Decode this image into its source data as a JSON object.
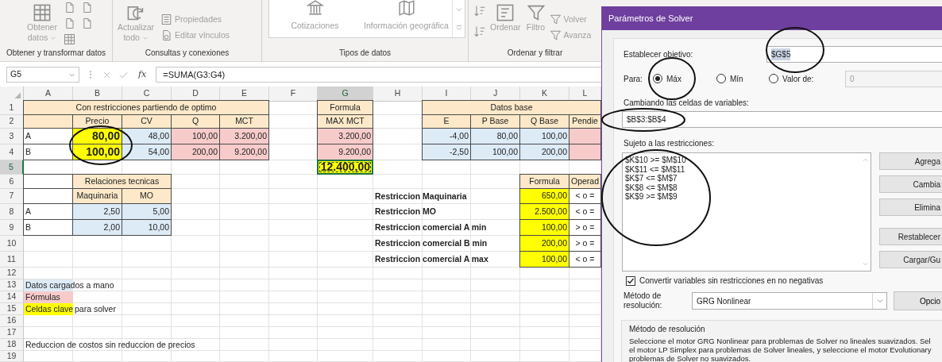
{
  "ribbon": [
    {
      "label": "Obtener y transformar datos",
      "buttons": [
        {
          "kind": "large",
          "lines": [
            "Obtener",
            "datos"
          ],
          "dropdown": true
        }
      ]
    },
    {
      "label": "Consultas y conexiones",
      "buttons": [
        {
          "kind": "large",
          "lines": [
            "Actualizar",
            "todo"
          ],
          "dropdown": true
        },
        {
          "kind": "small",
          "lines": [
            "Propiedades"
          ]
        },
        {
          "kind": "small",
          "lines": [
            "Editar vínculos"
          ]
        }
      ]
    },
    {
      "label": "Tipos de datos",
      "buttons": [
        {
          "kind": "gallery",
          "lines": [
            "Cotizaciones"
          ]
        },
        {
          "kind": "gallery",
          "lines": [
            "Información geográfica"
          ]
        }
      ]
    },
    {
      "label": "Ordenar y filtrar",
      "buttons": [
        {
          "kind": "large",
          "lines": [
            "Ordenar"
          ]
        },
        {
          "kind": "large",
          "lines": [
            "Filtro"
          ]
        },
        {
          "kind": "small",
          "lines": [
            "Volver"
          ]
        },
        {
          "kind": "small",
          "lines": [
            "Avanza"
          ]
        }
      ]
    }
  ],
  "formula_bar": {
    "name_box": "G5",
    "function_label": "fx",
    "formula": "=SUMA(G3:G4)"
  },
  "sheet": {
    "columns": [
      {
        "label": "A",
        "selected": false
      },
      {
        "label": "B",
        "selected": false
      },
      {
        "label": "C",
        "selected": false
      },
      {
        "label": "D",
        "selected": false
      },
      {
        "label": "E",
        "selected": false
      },
      {
        "label": "F",
        "selected": false
      },
      {
        "label": "G",
        "selected": true
      },
      {
        "label": "H",
        "selected": false
      },
      {
        "label": "I",
        "selected": false
      },
      {
        "label": "J",
        "selected": false
      },
      {
        "label": "K",
        "selected": false
      },
      {
        "label": "L",
        "selected": false
      }
    ],
    "rows": [
      {
        "number": "1",
        "selected": false,
        "cells": [
          {
            "text": "Con restricciones partiendo de optimo",
            "kind": "header",
            "color": "#fde9c9",
            "boxed": true
          },
          {
            "merged": true
          },
          {
            "merged": true
          },
          {
            "merged": true
          },
          {
            "merged": true
          },
          null,
          {
            "text": "Formula",
            "kind": "header",
            "color": "#fde9c9",
            "boxed": true
          },
          null,
          {
            "text": "Datos base",
            "kind": "header",
            "color": "#fde9c9",
            "boxed": true
          },
          {
            "merged": true
          },
          {
            "merged": true
          },
          {
            "merged": true
          }
        ]
      },
      {
        "number": "2",
        "selected": false,
        "cells": [
          {
            "kind": "header",
            "color": "#fde9c9",
            "boxed": true
          },
          {
            "text": "Precio",
            "kind": "header",
            "color": "#fde9c9",
            "boxed": true
          },
          {
            "text": "CV",
            "kind": "header",
            "color": "#fde9c9",
            "boxed": true
          },
          {
            "text": "Q",
            "kind": "header",
            "color": "#fde9c9",
            "boxed": true
          },
          {
            "text": "MCT",
            "kind": "header",
            "color": "#fde9c9",
            "boxed": true
          },
          null,
          {
            "text": "MAX MCT",
            "kind": "header",
            "color": "#fde9c9",
            "boxed": true
          },
          null,
          {
            "text": "E",
            "kind": "header",
            "color": "#fde9c9",
            "boxed": true
          },
          {
            "text": "P Base",
            "kind": "header",
            "color": "#fde9c9",
            "boxed": true
          },
          {
            "text": "Q Base",
            "kind": "header",
            "color": "#fde9c9",
            "boxed": true
          },
          {
            "text": "Pendie",
            "kind": "header",
            "color": "#fde9c9",
            "boxed": true
          }
        ]
      },
      {
        "number": "3",
        "selected": false,
        "cells": [
          {
            "text": "A",
            "kind": "label",
            "boxed": true
          },
          {
            "text": "80,00",
            "kind": "number",
            "color": "#ffff00",
            "bold": true,
            "boxed": true
          },
          {
            "text": "48,00",
            "kind": "number",
            "color": "#ddebf7",
            "boxed": true
          },
          {
            "text": "100,00",
            "kind": "number",
            "color": "#f8cbcb",
            "boxed": true
          },
          {
            "text": "3.200,00",
            "kind": "number",
            "color": "#f8cbcb",
            "boxed": true
          },
          null,
          {
            "text": "3.200,00",
            "kind": "number",
            "color": "#f8cbcb",
            "boxed": true
          },
          null,
          {
            "text": "-4,00",
            "kind": "number",
            "color": "#ddebf7",
            "boxed": true
          },
          {
            "text": "80,00",
            "kind": "number",
            "color": "#ddebf7",
            "boxed": true
          },
          {
            "text": "100,00",
            "kind": "number",
            "color": "#ddebf7",
            "boxed": true
          },
          {
            "kind": "number",
            "color": "#f8cbcb",
            "boxed": true
          }
        ]
      },
      {
        "number": "4",
        "selected": false,
        "cells": [
          {
            "text": "B",
            "kind": "label",
            "boxed": true
          },
          {
            "text": "100,00",
            "kind": "number",
            "color": "#ffff00",
            "bold": true,
            "boxed": true
          },
          {
            "text": "54,00",
            "kind": "number",
            "color": "#ddebf7",
            "boxed": true
          },
          {
            "text": "200,00",
            "kind": "number",
            "color": "#f8cbcb",
            "boxed": true
          },
          {
            "text": "9.200,00",
            "kind": "number",
            "color": "#f8cbcb",
            "boxed": true
          },
          null,
          {
            "text": "9.200,00",
            "kind": "number",
            "color": "#f8cbcb",
            "boxed": true
          },
          null,
          {
            "text": "-2,50",
            "kind": "number",
            "color": "#ddebf7",
            "boxed": true
          },
          {
            "text": "100,00",
            "kind": "number",
            "color": "#ddebf7",
            "boxed": true
          },
          {
            "text": "200,00",
            "kind": "number",
            "color": "#ddebf7",
            "boxed": true
          },
          {
            "kind": "number",
            "color": "#f8cbcb",
            "boxed": true
          }
        ]
      },
      {
        "number": "5",
        "selected": true,
        "cells": [
          null,
          null,
          null,
          null,
          null,
          null,
          {
            "text": "12.400,00",
            "kind": "number",
            "color": "#ffff00",
            "bold": true,
            "boxed": true
          }
        ]
      },
      {
        "number": "6",
        "selected": false,
        "cells": [
          {
            "kind": "label",
            "boxed": true
          },
          {
            "text": "Relaciones tecnicas",
            "kind": "header",
            "color": "#fde9c9",
            "boxed": true
          },
          {
            "merged": true
          },
          null,
          null,
          null,
          null,
          null,
          null,
          null,
          {
            "text": "Formula",
            "kind": "header",
            "color": "#fde9c9",
            "boxed": true
          },
          {
            "text": "Operad",
            "kind": "header",
            "color": "#fde9c9",
            "boxed": true
          }
        ]
      },
      {
        "number": "7",
        "selected": false,
        "cells": [
          {
            "kind": "label",
            "boxed": true
          },
          {
            "text": "Maquinaria",
            "kind": "header",
            "color": "#fde9c9",
            "boxed": true
          },
          {
            "text": "MO",
            "kind": "header",
            "color": "#fde9c9",
            "boxed": true
          },
          null,
          null,
          null,
          null,
          {
            "text": "Restriccion Maquinaria",
            "kind": "label",
            "bold": true
          },
          null,
          null,
          {
            "text": "650,00",
            "kind": "number",
            "color": "#ffff00",
            "boxed": true
          },
          {
            "text": "< o =",
            "kind": "center",
            "boxed": true
          }
        ]
      },
      {
        "number": "8",
        "selected": false,
        "cells": [
          {
            "text": "A",
            "kind": "label",
            "boxed": true
          },
          {
            "text": "2,50",
            "kind": "number",
            "color": "#ddebf7",
            "boxed": true
          },
          {
            "text": "5,00",
            "kind": "number",
            "color": "#ddebf7",
            "boxed": true
          },
          null,
          null,
          null,
          null,
          {
            "text": "Restriccion MO",
            "kind": "label",
            "bold": true
          },
          null,
          null,
          {
            "text": "2.500,00",
            "kind": "number",
            "color": "#ffff00",
            "boxed": true
          },
          {
            "text": "< o =",
            "kind": "center",
            "boxed": true
          }
        ]
      },
      {
        "number": "9",
        "selected": false,
        "cells": [
          {
            "text": "B",
            "kind": "label",
            "boxed": true
          },
          {
            "text": "2,00",
            "kind": "number",
            "color": "#ddebf7",
            "boxed": true
          },
          {
            "text": "10,00",
            "kind": "number",
            "color": "#ddebf7",
            "boxed": true
          },
          null,
          null,
          null,
          null,
          {
            "text": "Restriccion comercial A min",
            "kind": "label",
            "bold": true
          },
          null,
          null,
          {
            "text": "100,00",
            "kind": "number",
            "color": "#ffff00",
            "boxed": true
          },
          {
            "text": "> o =",
            "kind": "center",
            "boxed": true
          }
        ]
      },
      {
        "number": "10",
        "selected": false,
        "cells": [
          null,
          null,
          null,
          null,
          null,
          null,
          null,
          {
            "text": "Restriccion comercial B min",
            "kind": "label",
            "bold": true
          },
          null,
          null,
          {
            "text": "200,00",
            "kind": "number",
            "color": "#ffff00",
            "boxed": true
          },
          {
            "text": "> o =",
            "kind": "center",
            "boxed": true
          }
        ]
      },
      {
        "number": "11",
        "selected": false,
        "cells": [
          null,
          null,
          null,
          null,
          null,
          null,
          null,
          {
            "text": "Restriccion comercial A max",
            "kind": "label",
            "bold": true
          },
          null,
          null,
          {
            "text": "100,00",
            "kind": "number",
            "color": "#ffff00",
            "boxed": true
          },
          {
            "text": "< o =",
            "kind": "center",
            "boxed": true
          }
        ]
      },
      {
        "number": "12",
        "selected": false
      },
      {
        "number": "13",
        "selected": false,
        "cells": [
          {
            "text": "Datos cargados a mano",
            "kind": "label",
            "color": "#ddebf7"
          }
        ]
      },
      {
        "number": "14",
        "selected": false,
        "cells": [
          {
            "text": "Fórmulas",
            "kind": "label",
            "color": "#f8cbcb"
          }
        ]
      },
      {
        "number": "15",
        "selected": false,
        "cells": [
          {
            "text": "Celdas clave",
            "kind": "label",
            "color": "#ffff00"
          },
          {
            "text": "para solver",
            "kind": "label"
          }
        ]
      },
      {
        "number": "16",
        "selected": false
      },
      {
        "number": "17",
        "selected": false
      },
      {
        "number": "18",
        "selected": false,
        "cells": [
          {
            "text": "Reduccion de costos sin reduccion de precios",
            "kind": "label"
          }
        ]
      },
      {
        "number": "19",
        "selected": false
      }
    ]
  },
  "solver_dialog": {
    "title": "Parámetros de Solver",
    "objective": {
      "label": "Establecer objetivo:",
      "value": "$G$5",
      "highlighted": true
    },
    "goal": {
      "label": "Para:",
      "options": [
        {
          "label": "Máx",
          "selected": true
        },
        {
          "label": "Mín",
          "selected": false
        },
        {
          "label": "Valor de:",
          "selected": false
        }
      ],
      "value_field": {
        "value": "0",
        "disabled": true
      }
    },
    "variables": {
      "label": "Cambiando las celdas de variables:",
      "value": "$B$3:$B$4"
    },
    "constraints": {
      "label": "Sujeto a las restricciones:",
      "items": [
        "$K$10 >= $M$10",
        "$K$11 <= $M$11",
        "$K$7 <= $M$7",
        "$K$8 <= $M$8",
        "$K$9 >= $M$9"
      ]
    },
    "side_buttons": [
      "Agrega",
      "Cambia",
      "Elimina",
      "Restablecer",
      "Cargar/Gu"
    ],
    "nonnegative": {
      "label": "Convertir variables sin restricciones en no negativas",
      "checked": true
    },
    "method": {
      "label": "Método de resolución:",
      "value": "GRG Nonlinear"
    },
    "options_button": "Opcio",
    "method_group": {
      "title": "Método de resolución",
      "lines": [
        "Seleccione el motor GRG Nonlinear para problemas de Solver no lineales suavizados. Sel",
        "el motor LP Simplex para problemas de Solver lineales, y seleccione el motor Evolutionary",
        "problemas de Solver no suavizados."
      ]
    }
  }
}
